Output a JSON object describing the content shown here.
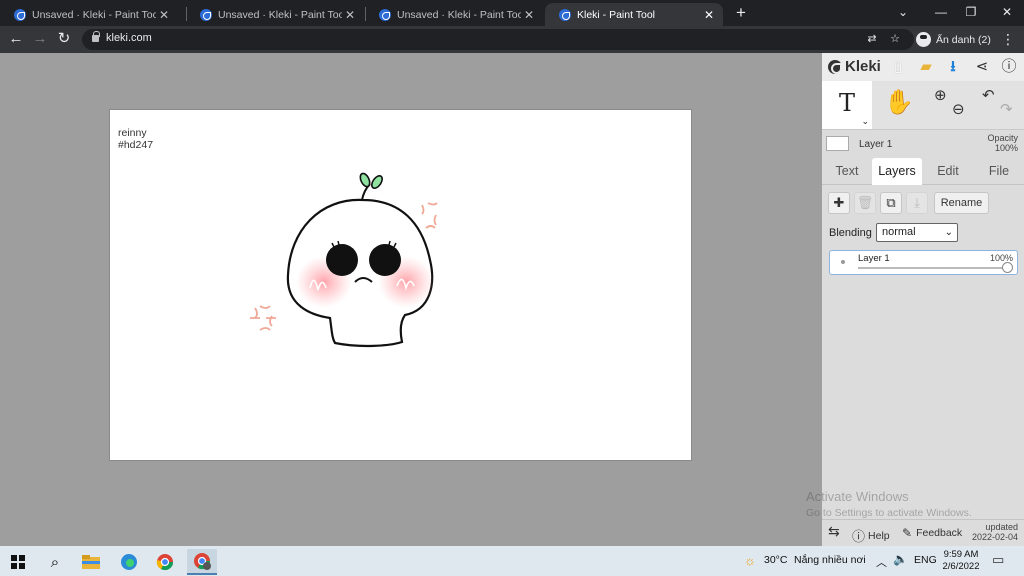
{
  "browser": {
    "tabs": [
      {
        "title": "Unsaved · Kleki - Paint Tool",
        "active": false
      },
      {
        "title": "Unsaved · Kleki - Paint Tool",
        "active": false
      },
      {
        "title": "Unsaved · Kleki - Paint Tool",
        "active": false
      },
      {
        "title": "Kleki - Paint Tool",
        "active": true
      }
    ],
    "new_tab": "+",
    "url": "kleki.com",
    "profile_label": "Ẩn danh (2)"
  },
  "canvas": {
    "text_line1": "reinny",
    "text_line2": "#hd247"
  },
  "panel": {
    "logo": "Kleki",
    "active_tool": "T",
    "current_layer_name": "Layer 1",
    "opacity_label": "Opacity",
    "opacity_value": "100%",
    "tabs": [
      "Text",
      "Layers",
      "Edit",
      "File"
    ],
    "active_tab": "Layers",
    "rename_label": "Rename",
    "blending_label": "Blending",
    "blending_value": "normal",
    "layers": [
      {
        "name": "Layer 1",
        "opacity": "100%"
      }
    ],
    "footer": {
      "help": "Help",
      "feedback": "Feedback",
      "updated_label": "updated",
      "updated_date": "2022-02-04"
    }
  },
  "watermark": {
    "line1": "Activate Windows",
    "line2": "Go to Settings to activate Windows."
  },
  "taskbar": {
    "weather": "30°C",
    "weather_desc": "Nắng nhiều nơi",
    "language": "ENG",
    "time": "9:59 AM",
    "date": "2/6/2022"
  }
}
